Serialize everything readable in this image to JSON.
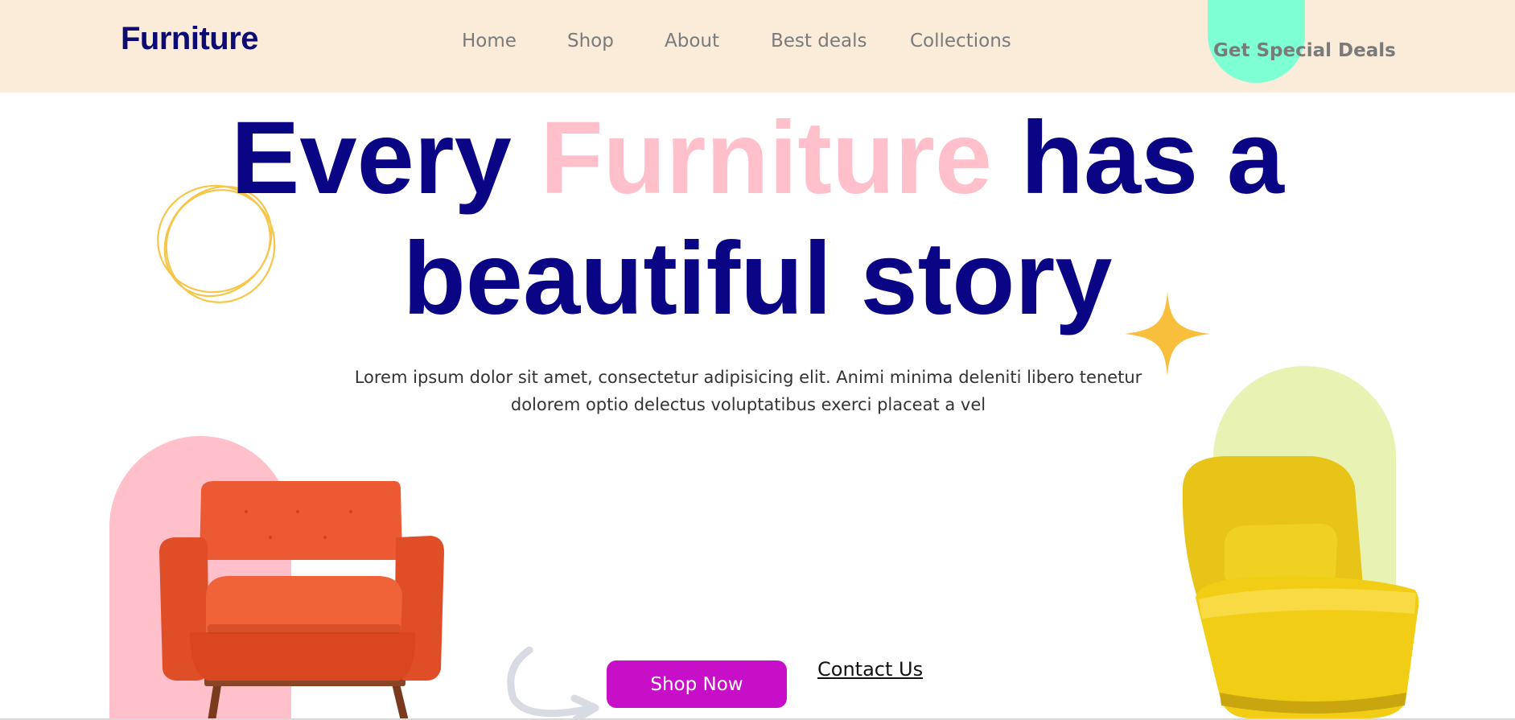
{
  "header": {
    "logo": "Furniture",
    "nav": [
      {
        "label": "Home"
      },
      {
        "label": "Shop"
      },
      {
        "label": "About"
      },
      {
        "label": "Best deals"
      },
      {
        "label": "Collections"
      }
    ],
    "cta_label": "Get Special Deals"
  },
  "hero": {
    "headline_part1": "Every",
    "headline_accent": "Furniture",
    "headline_part2": "has a",
    "headline_line2": "beautiful story",
    "description": "Lorem ipsum dolor sit amet, consectetur adipisicing elit. Animi minima deleniti libero tenetur dolorem optio delectus voluptatibus exerci placeat a vel",
    "primary_button": "Shop Now",
    "secondary_link": "Contact Us"
  },
  "icons": {
    "rings": "rings-icon",
    "sparkle": "sparkle-icon",
    "arrow": "curved-arrow-icon"
  },
  "colors": {
    "header_bg": "#fbebd9",
    "brand_navy": "#0a0585",
    "accent_pink": "#ffc0cb",
    "cta_mint": "#7fffd4",
    "button_magenta": "#c80fc8",
    "arch_green": "#e8f3b3",
    "ring_yellow": "#f6c64a"
  }
}
